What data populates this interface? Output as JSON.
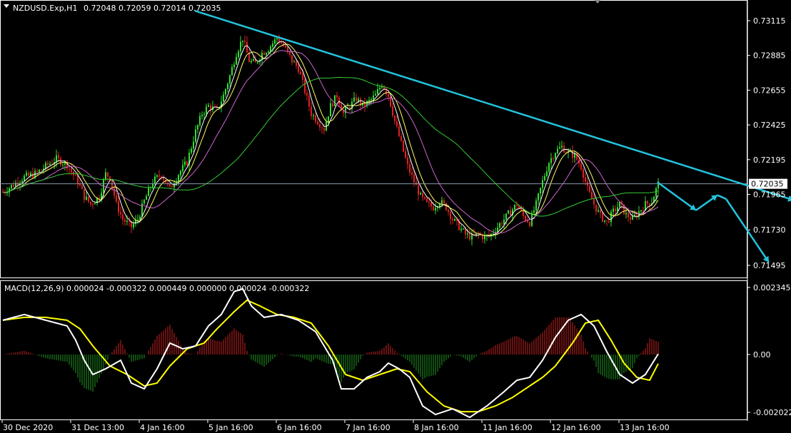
{
  "chart_data": {
    "type": "candlestick",
    "title": "NZDUSD.Exp,H1",
    "ohlc_header": [
      "0.72048",
      "0.72059",
      "0.72014",
      "0.72035"
    ],
    "price_axis": {
      "ticks": [
        "0.73115",
        "0.72885",
        "0.72655",
        "0.72425",
        "0.72195",
        "0.71965",
        "0.71730",
        "0.71495"
      ],
      "tick_values": [
        0.73115,
        0.72885,
        0.72655,
        0.72425,
        0.72195,
        0.71965,
        0.7173,
        0.71495
      ],
      "current_price": "0.72035",
      "current_value": 0.72035
    },
    "time_axis": {
      "labels": [
        "30 Dec 2020",
        "31 Dec 13:00",
        "4 Jan 16:00",
        "5 Jan 16:00",
        "6 Jan 16:00",
        "7 Jan 16:00",
        "8 Jan 16:00",
        "11 Jan 16:00",
        "12 Jan 16:00",
        "13 Jan 16:00"
      ]
    },
    "price_path": [
      [
        0,
        0.7198
      ],
      [
        5,
        0.7203
      ],
      [
        10,
        0.7208
      ],
      [
        15,
        0.721
      ],
      [
        20,
        0.7215
      ],
      [
        25,
        0.722
      ],
      [
        30,
        0.7216
      ],
      [
        35,
        0.7205
      ],
      [
        38,
        0.7195
      ],
      [
        41,
        0.719
      ],
      [
        45,
        0.7195
      ],
      [
        48,
        0.721
      ],
      [
        50,
        0.7208
      ],
      [
        53,
        0.719
      ],
      [
        56,
        0.718
      ],
      [
        60,
        0.7175
      ],
      [
        63,
        0.718
      ],
      [
        66,
        0.7192
      ],
      [
        70,
        0.7205
      ],
      [
        74,
        0.721
      ],
      [
        78,
        0.72
      ],
      [
        82,
        0.721
      ],
      [
        86,
        0.7218
      ],
      [
        90,
        0.7238
      ],
      [
        93,
        0.725
      ],
      [
        96,
        0.7255
      ],
      [
        100,
        0.7252
      ],
      [
        103,
        0.7262
      ],
      [
        106,
        0.7275
      ],
      [
        109,
        0.729
      ],
      [
        112,
        0.73
      ],
      [
        115,
        0.7285
      ],
      [
        118,
        0.7283
      ],
      [
        121,
        0.729
      ],
      [
        124,
        0.7293
      ],
      [
        128,
        0.73
      ],
      [
        131,
        0.7295
      ],
      [
        135,
        0.7285
      ],
      [
        138,
        0.728
      ],
      [
        141,
        0.7265
      ],
      [
        144,
        0.725
      ],
      [
        147,
        0.7245
      ],
      [
        150,
        0.724
      ],
      [
        153,
        0.7255
      ],
      [
        156,
        0.7262
      ],
      [
        159,
        0.725
      ],
      [
        162,
        0.7255
      ],
      [
        165,
        0.726
      ],
      [
        168,
        0.7255
      ],
      [
        171,
        0.7258
      ],
      [
        174,
        0.7262
      ],
      [
        177,
        0.727
      ],
      [
        180,
        0.7262
      ],
      [
        183,
        0.7245
      ],
      [
        186,
        0.723
      ],
      [
        189,
        0.7215
      ],
      [
        192,
        0.7205
      ],
      [
        195,
        0.7195
      ],
      [
        198,
        0.719
      ],
      [
        201,
        0.7188
      ],
      [
        204,
        0.7192
      ],
      [
        207,
        0.7188
      ],
      [
        210,
        0.718
      ],
      [
        213,
        0.7175
      ],
      [
        216,
        0.717
      ],
      [
        219,
        0.7168
      ],
      [
        222,
        0.717
      ],
      [
        225,
        0.7168
      ],
      [
        228,
        0.717
      ],
      [
        231,
        0.7175
      ],
      [
        234,
        0.718
      ],
      [
        237,
        0.7185
      ],
      [
        240,
        0.719
      ],
      [
        243,
        0.7182
      ],
      [
        246,
        0.7178
      ],
      [
        249,
        0.719
      ],
      [
        252,
        0.7205
      ],
      [
        255,
        0.7218
      ],
      [
        258,
        0.7225
      ],
      [
        261,
        0.7228
      ],
      [
        264,
        0.7224
      ],
      [
        267,
        0.7222
      ],
      [
        270,
        0.7215
      ],
      [
        273,
        0.72
      ],
      [
        276,
        0.719
      ],
      [
        279,
        0.7182
      ],
      [
        282,
        0.7178
      ],
      [
        285,
        0.7185
      ],
      [
        288,
        0.719
      ],
      [
        291,
        0.7183
      ],
      [
        294,
        0.718
      ],
      [
        297,
        0.7185
      ],
      [
        300,
        0.719
      ],
      [
        303,
        0.7192
      ],
      [
        306,
        0.72035
      ]
    ],
    "moving_averages": [
      {
        "color": "#ffffff",
        "period": 5
      },
      {
        "color": "#ffff66",
        "period": 9
      },
      {
        "color": "#cc66cc",
        "period": 20
      },
      {
        "color": "#33cc33",
        "period": 60
      }
    ],
    "trendline": {
      "color": "#22c4dd",
      "from": [
        90,
        0.7318
      ],
      "to": [
        370,
        0.71925
      ]
    },
    "projection": {
      "color": "#22c4dd",
      "path": [
        [
          306,
          0.72045
        ],
        [
          324,
          0.7186
        ],
        [
          334,
          0.7196
        ],
        [
          338,
          0.71935
        ],
        [
          358,
          0.71515
        ]
      ]
    },
    "macd": {
      "label": "MACD(12,26,9) 0.000024 -0.000322 0.000449 0.000000 0.000024 -0.000322",
      "axis_ticks": [
        "0.002345",
        "0.00",
        "-0.002022"
      ],
      "axis_values": [
        0.002345,
        0.0,
        -0.002022
      ],
      "macd_color": "#ffffff",
      "signal_color": "#ffff00",
      "hist_pos_color": "#cc2222",
      "hist_neg_color": "#229922",
      "macd_path": [
        [
          0,
          0.0012
        ],
        [
          10,
          0.0014
        ],
        [
          20,
          0.0012
        ],
        [
          30,
          0.001
        ],
        [
          34,
          0.0005
        ],
        [
          38,
          -0.0002
        ],
        [
          42,
          -0.0007
        ],
        [
          48,
          -0.0005
        ],
        [
          55,
          -0.0002
        ],
        [
          60,
          -0.001
        ],
        [
          66,
          -0.0012
        ],
        [
          72,
          -0.0005
        ],
        [
          78,
          0.0004
        ],
        [
          84,
          0.0002
        ],
        [
          90,
          0.0003
        ],
        [
          96,
          0.001
        ],
        [
          102,
          0.0014
        ],
        [
          108,
          0.0022
        ],
        [
          112,
          0.0023
        ],
        [
          116,
          0.0017
        ],
        [
          122,
          0.0013
        ],
        [
          130,
          0.0014
        ],
        [
          138,
          0.0012
        ],
        [
          146,
          0.0008
        ],
        [
          154,
          -0.0002
        ],
        [
          158,
          -0.0012
        ],
        [
          164,
          -0.0012
        ],
        [
          170,
          -0.0008
        ],
        [
          176,
          -0.0006
        ],
        [
          180,
          -0.0003
        ],
        [
          185,
          -0.0005
        ],
        [
          190,
          -0.0008
        ],
        [
          196,
          -0.0018
        ],
        [
          202,
          -0.0021
        ],
        [
          210,
          -0.0019
        ],
        [
          218,
          -0.0022
        ],
        [
          226,
          -0.0018
        ],
        [
          234,
          -0.0013
        ],
        [
          240,
          -0.0009
        ],
        [
          246,
          -0.0008
        ],
        [
          252,
          -0.0002
        ],
        [
          258,
          0.0006
        ],
        [
          264,
          0.0012
        ],
        [
          270,
          0.0014
        ],
        [
          276,
          0.001
        ],
        [
          282,
          0.0001
        ],
        [
          288,
          -0.0007
        ],
        [
          294,
          -0.001
        ],
        [
          300,
          -0.0007
        ],
        [
          306,
          2e-05
        ]
      ],
      "signal_path": [
        [
          0,
          0.0012
        ],
        [
          10,
          0.0013
        ],
        [
          20,
          0.0013
        ],
        [
          30,
          0.0012
        ],
        [
          36,
          0.0009
        ],
        [
          42,
          0.0003
        ],
        [
          50,
          -0.0004
        ],
        [
          58,
          -0.0007
        ],
        [
          66,
          -0.0011
        ],
        [
          72,
          -0.001
        ],
        [
          78,
          -0.0004
        ],
        [
          86,
          0.0002
        ],
        [
          94,
          0.0004
        ],
        [
          100,
          0.0009
        ],
        [
          108,
          0.0015
        ],
        [
          114,
          0.0019
        ],
        [
          120,
          0.0017
        ],
        [
          128,
          0.0014
        ],
        [
          136,
          0.0013
        ],
        [
          144,
          0.0011
        ],
        [
          152,
          0.0003
        ],
        [
          160,
          -0.0007
        ],
        [
          168,
          -0.0009
        ],
        [
          176,
          -0.0007
        ],
        [
          184,
          -0.0005
        ],
        [
          190,
          -0.0006
        ],
        [
          198,
          -0.0013
        ],
        [
          206,
          -0.0018
        ],
        [
          214,
          -0.002
        ],
        [
          222,
          -0.002
        ],
        [
          230,
          -0.0018
        ],
        [
          238,
          -0.0015
        ],
        [
          246,
          -0.0011
        ],
        [
          252,
          -0.0008
        ],
        [
          258,
          -0.0004
        ],
        [
          266,
          0.0004
        ],
        [
          272,
          0.0011
        ],
        [
          278,
          0.0012
        ],
        [
          284,
          0.0005
        ],
        [
          290,
          -0.0003
        ],
        [
          296,
          -0.0008
        ],
        [
          302,
          -0.0009
        ],
        [
          306,
          -0.00032
        ]
      ]
    }
  }
}
